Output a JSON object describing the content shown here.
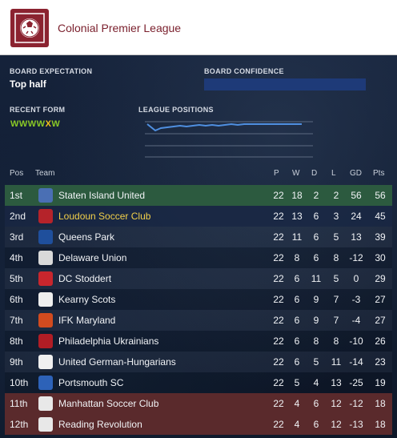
{
  "header": {
    "title": "Colonial Premier League"
  },
  "board": {
    "expectation_label": "BOARD EXPECTATION",
    "expectation_value": "Top half",
    "confidence_label": "BOARD CONFIDENCE"
  },
  "form": {
    "label": "RECENT FORM",
    "results": [
      "W",
      "W",
      "W",
      "W",
      "X",
      "W"
    ]
  },
  "positions": {
    "label": "LEAGUE POSITIONS"
  },
  "table": {
    "headers": {
      "pos": "Pos",
      "team": "Team",
      "p": "P",
      "w": "W",
      "d": "D",
      "l": "L",
      "gd": "GD",
      "pts": "Pts"
    },
    "rows": [
      {
        "pos": "1st",
        "team": "Staten Island United",
        "p": "22",
        "w": "18",
        "d": "2",
        "l": "2",
        "gd": "56",
        "pts": "56",
        "highlight": "green",
        "badge": "#4a6fb4"
      },
      {
        "pos": "2nd",
        "team": "Loudoun Soccer Club",
        "p": "22",
        "w": "13",
        "d": "6",
        "l": "3",
        "gd": "24",
        "pts": "45",
        "highlight": "user",
        "badge": "#b5232a"
      },
      {
        "pos": "3rd",
        "team": "Queens Park",
        "p": "22",
        "w": "11",
        "d": "6",
        "l": "5",
        "gd": "13",
        "pts": "39",
        "highlight": "none",
        "badge": "#1f4f9c"
      },
      {
        "pos": "4th",
        "team": "Delaware Union",
        "p": "22",
        "w": "8",
        "d": "6",
        "l": "8",
        "gd": "-12",
        "pts": "30",
        "highlight": "none",
        "badge": "#d9d9d9"
      },
      {
        "pos": "5th",
        "team": "DC Stoddert",
        "p": "22",
        "w": "6",
        "d": "11",
        "l": "5",
        "gd": "0",
        "pts": "29",
        "highlight": "none",
        "badge": "#c8262d"
      },
      {
        "pos": "6th",
        "team": "Kearny Scots",
        "p": "22",
        "w": "6",
        "d": "9",
        "l": "7",
        "gd": "-3",
        "pts": "27",
        "highlight": "none",
        "badge": "#eeeeee"
      },
      {
        "pos": "7th",
        "team": "IFK Maryland",
        "p": "22",
        "w": "6",
        "d": "9",
        "l": "7",
        "gd": "-4",
        "pts": "27",
        "highlight": "none",
        "badge": "#d24b1f"
      },
      {
        "pos": "8th",
        "team": "Philadelphia Ukrainians",
        "p": "22",
        "w": "6",
        "d": "8",
        "l": "8",
        "gd": "-10",
        "pts": "26",
        "highlight": "none",
        "badge": "#b11d25"
      },
      {
        "pos": "9th",
        "team": "United German-Hungarians",
        "p": "22",
        "w": "6",
        "d": "5",
        "l": "11",
        "gd": "-14",
        "pts": "23",
        "highlight": "none",
        "badge": "#f0f0f0"
      },
      {
        "pos": "10th",
        "team": "Portsmouth SC",
        "p": "22",
        "w": "5",
        "d": "4",
        "l": "13",
        "gd": "-25",
        "pts": "19",
        "highlight": "none",
        "badge": "#2d62b8"
      },
      {
        "pos": "11th",
        "team": "Manhattan Soccer Club",
        "p": "22",
        "w": "4",
        "d": "6",
        "l": "12",
        "gd": "-12",
        "pts": "18",
        "highlight": "red",
        "badge": "#e8e8e8"
      },
      {
        "pos": "12th",
        "team": "Reading Revolution",
        "p": "22",
        "w": "4",
        "d": "6",
        "l": "12",
        "gd": "-13",
        "pts": "18",
        "highlight": "red",
        "badge": "#e8e8e8"
      }
    ]
  },
  "colors": {
    "user_team": "#f2d04a",
    "promotion": "#2c5a3f",
    "relegation": "#5a2a2c",
    "brand": "#8b2330",
    "form_win": "#8ac926",
    "form_other": "#f2c21a"
  }
}
